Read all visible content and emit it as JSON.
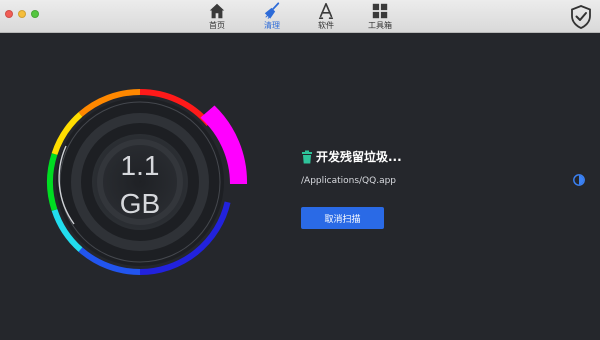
{
  "window": {
    "traffic_lights": [
      "close",
      "minimize",
      "zoom"
    ]
  },
  "toolbar": {
    "tabs": [
      {
        "label": "首页",
        "icon": "home-icon"
      },
      {
        "label": "清理",
        "icon": "broom-icon",
        "active": true
      },
      {
        "label": "软件",
        "icon": "appstore-icon"
      },
      {
        "label": "工具箱",
        "icon": "grid-icon"
      }
    ],
    "shield_icon": "shield-check-icon"
  },
  "scan": {
    "size_value": "1.1",
    "size_unit": "GB",
    "status_text": "开发残留垃圾...",
    "current_path": "/Applications/QQ.app",
    "cancel_label": "取消扫描"
  },
  "colors": {
    "accent": "#2a6ae6",
    "background": "#25272c",
    "ring_segments": [
      "#ff1a1a",
      "#ff00ff",
      "#2222dd",
      "#22ddee",
      "#00dd22",
      "#ffdd00",
      "#ff8800"
    ]
  }
}
